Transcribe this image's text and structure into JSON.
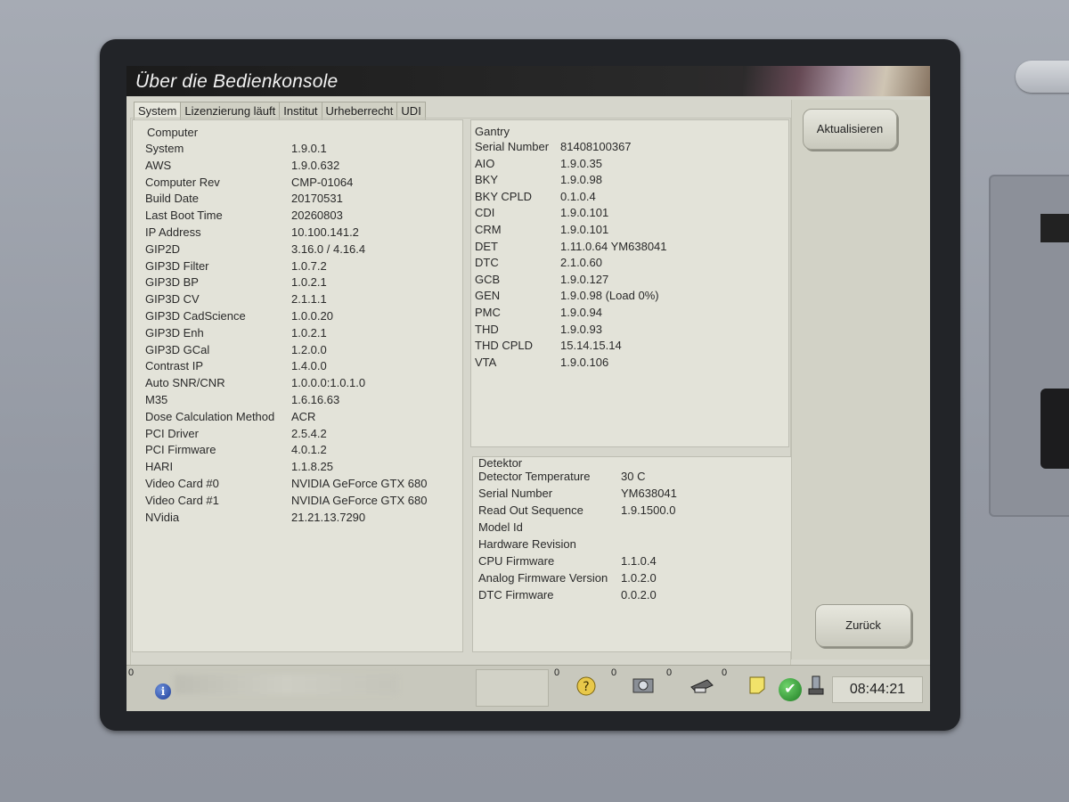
{
  "window": {
    "title": "Über die Bedienkonsole"
  },
  "tabs": [
    "System",
    "Lizenzierung läuft",
    "Institut",
    "Urheberrecht",
    "UDI"
  ],
  "computer": {
    "heading": "Computer",
    "rows": [
      {
        "label": "System",
        "value": "1.9.0.1"
      },
      {
        "label": "AWS",
        "value": "1.9.0.632"
      },
      {
        "label": "Computer Rev",
        "value": "CMP-01064"
      },
      {
        "label": "Build Date",
        "value": "20170531"
      },
      {
        "label": "Last Boot Time",
        "value": "20260803"
      },
      {
        "label": "IP Address",
        "value": "10.100.141.2"
      },
      {
        "label": "GIP2D",
        "value": "3.16.0 / 4.16.4"
      },
      {
        "label": "GIP3D Filter",
        "value": "1.0.7.2"
      },
      {
        "label": "GIP3D BP",
        "value": "1.0.2.1"
      },
      {
        "label": "GIP3D CV",
        "value": "2.1.1.1"
      },
      {
        "label": "GIP3D CadScience",
        "value": "1.0.0.20"
      },
      {
        "label": "GIP3D Enh",
        "value": "1.0.2.1"
      },
      {
        "label": "GIP3D GCal",
        "value": "1.2.0.0"
      },
      {
        "label": "Contrast IP",
        "value": "1.4.0.0"
      },
      {
        "label": "Auto SNR/CNR",
        "value": "1.0.0.0:1.0.1.0"
      },
      {
        "label": "M35",
        "value": "1.6.16.63"
      },
      {
        "label": "Dose Calculation Method",
        "value": "ACR"
      },
      {
        "label": "PCI Driver",
        "value": "2.5.4.2"
      },
      {
        "label": "PCI Firmware",
        "value": "4.0.1.2"
      },
      {
        "label": "HARI",
        "value": "1.1.8.25"
      },
      {
        "label": "Video Card #0",
        "value": "NVIDIA GeForce GTX 680"
      },
      {
        "label": "Video Card #1",
        "value": "NVIDIA GeForce GTX 680"
      },
      {
        "label": "NVidia",
        "value": "21.21.13.7290"
      }
    ]
  },
  "gantry": {
    "heading": "Gantry",
    "rows": [
      {
        "label": "Serial Number",
        "value": "81408100367"
      },
      {
        "label": "AIO",
        "value": "1.9.0.35"
      },
      {
        "label": "BKY",
        "value": "1.9.0.98"
      },
      {
        "label": "BKY CPLD",
        "value": "0.1.0.4"
      },
      {
        "label": "CDI",
        "value": "1.9.0.101"
      },
      {
        "label": "CRM",
        "value": "1.9.0.101"
      },
      {
        "label": "DET",
        "value": "1.11.0.64   YM638041"
      },
      {
        "label": "DTC",
        "value": "2.1.0.60"
      },
      {
        "label": "GCB",
        "value": "1.9.0.127"
      },
      {
        "label": "GEN",
        "value": "1.9.0.98   (Load 0%)"
      },
      {
        "label": "PMC",
        "value": "1.9.0.94"
      },
      {
        "label": "THD",
        "value": "1.9.0.93"
      },
      {
        "label": "THD CPLD",
        "value": "15.14.15.14"
      },
      {
        "label": "VTA",
        "value": "1.9.0.106"
      }
    ]
  },
  "detektor": {
    "heading": "Detektor",
    "rows": [
      {
        "label": "Detector Temperature",
        "value": "30 C"
      },
      {
        "label": "Serial Number",
        "value": "YM638041"
      },
      {
        "label": "Read Out Sequence",
        "value": "1.9.1500.0"
      },
      {
        "label": "Model Id",
        "value": ""
      },
      {
        "label": "Hardware Revision",
        "value": ""
      },
      {
        "label": "CPU Firmware",
        "value": "1.1.0.4"
      },
      {
        "label": "Analog Firmware Version",
        "value": "1.0.2.0"
      },
      {
        "label": "DTC Firmware",
        "value": "0.0.2.0"
      }
    ]
  },
  "buttons": {
    "refresh": "Aktualisieren",
    "back": "Zurück"
  },
  "status": {
    "left_count": "0",
    "counts": [
      "0",
      "0",
      "0",
      "0"
    ],
    "icons": [
      "info-icon",
      "help-icon",
      "camera-icon",
      "printer-icon",
      "note-icon",
      "check-icon",
      "tube-icon"
    ],
    "time": "08:44:21"
  }
}
